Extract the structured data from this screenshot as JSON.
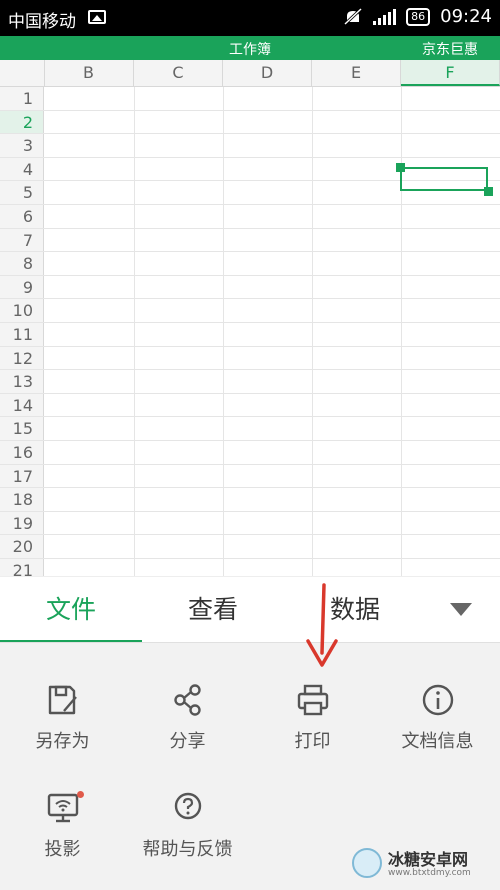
{
  "status": {
    "carrier": "中国移动",
    "battery": "86",
    "time": "09:24"
  },
  "titlebar": {
    "title": "工作簿",
    "ad": "京东巨惠"
  },
  "sheet": {
    "columns": [
      "B",
      "C",
      "D",
      "E",
      "F"
    ],
    "rows": [
      "1",
      "2",
      "3",
      "4",
      "5",
      "6",
      "7",
      "8",
      "9",
      "10",
      "11",
      "12",
      "13",
      "14",
      "15",
      "16",
      "17",
      "18",
      "19",
      "20",
      "21"
    ],
    "selected_cell": "F2"
  },
  "tabs": {
    "file": "文件",
    "view": "查看",
    "data": "数据"
  },
  "menu": {
    "save_as": "另存为",
    "share": "分享",
    "print": "打印",
    "doc_info": "文档信息",
    "project": "投影",
    "help": "帮助与反馈"
  },
  "watermark": {
    "name": "冰糖安卓网",
    "url": "www.btxtdmy.com"
  },
  "colors": {
    "accent": "#1aa35a",
    "arrow": "#d9382c"
  }
}
